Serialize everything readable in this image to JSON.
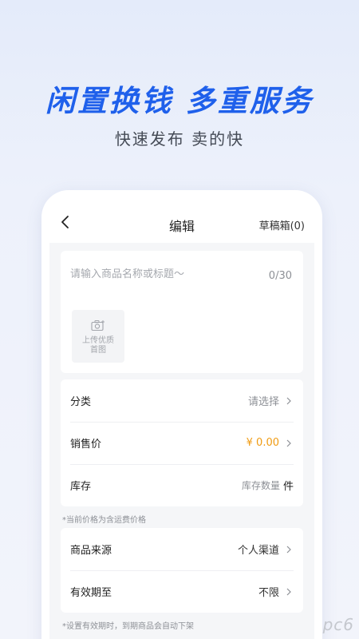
{
  "hero": {
    "slogan": "闲置换钱 多重服务",
    "sub_slogan": "快速发布 卖的快"
  },
  "nav": {
    "title": "编辑",
    "draft": "草稿箱(0)",
    "back_icon": "chevron-left-icon"
  },
  "title_field": {
    "placeholder": "请输入商品名称或标题～",
    "counter": "0/30"
  },
  "upload": {
    "icon": "camera-icon",
    "label": "上传优质\n首图"
  },
  "fields": {
    "category": {
      "label": "分类",
      "value": "请选择"
    },
    "price": {
      "label": "销售价",
      "value": "¥ 0.00"
    },
    "stock": {
      "label": "库存",
      "placeholder": "库存数量",
      "unit": "件"
    }
  },
  "note_price": "*当前价格为含运费价格",
  "fields2": {
    "source": {
      "label": "商品来源",
      "value": "个人渠道"
    },
    "validity": {
      "label": "有效期至",
      "value": "不限"
    }
  },
  "note_validity": "*设置有效期时，到期商品会自动下架",
  "watermark": "pc6",
  "colors": {
    "accent": "#1f60eb",
    "price": "#f09b12"
  }
}
